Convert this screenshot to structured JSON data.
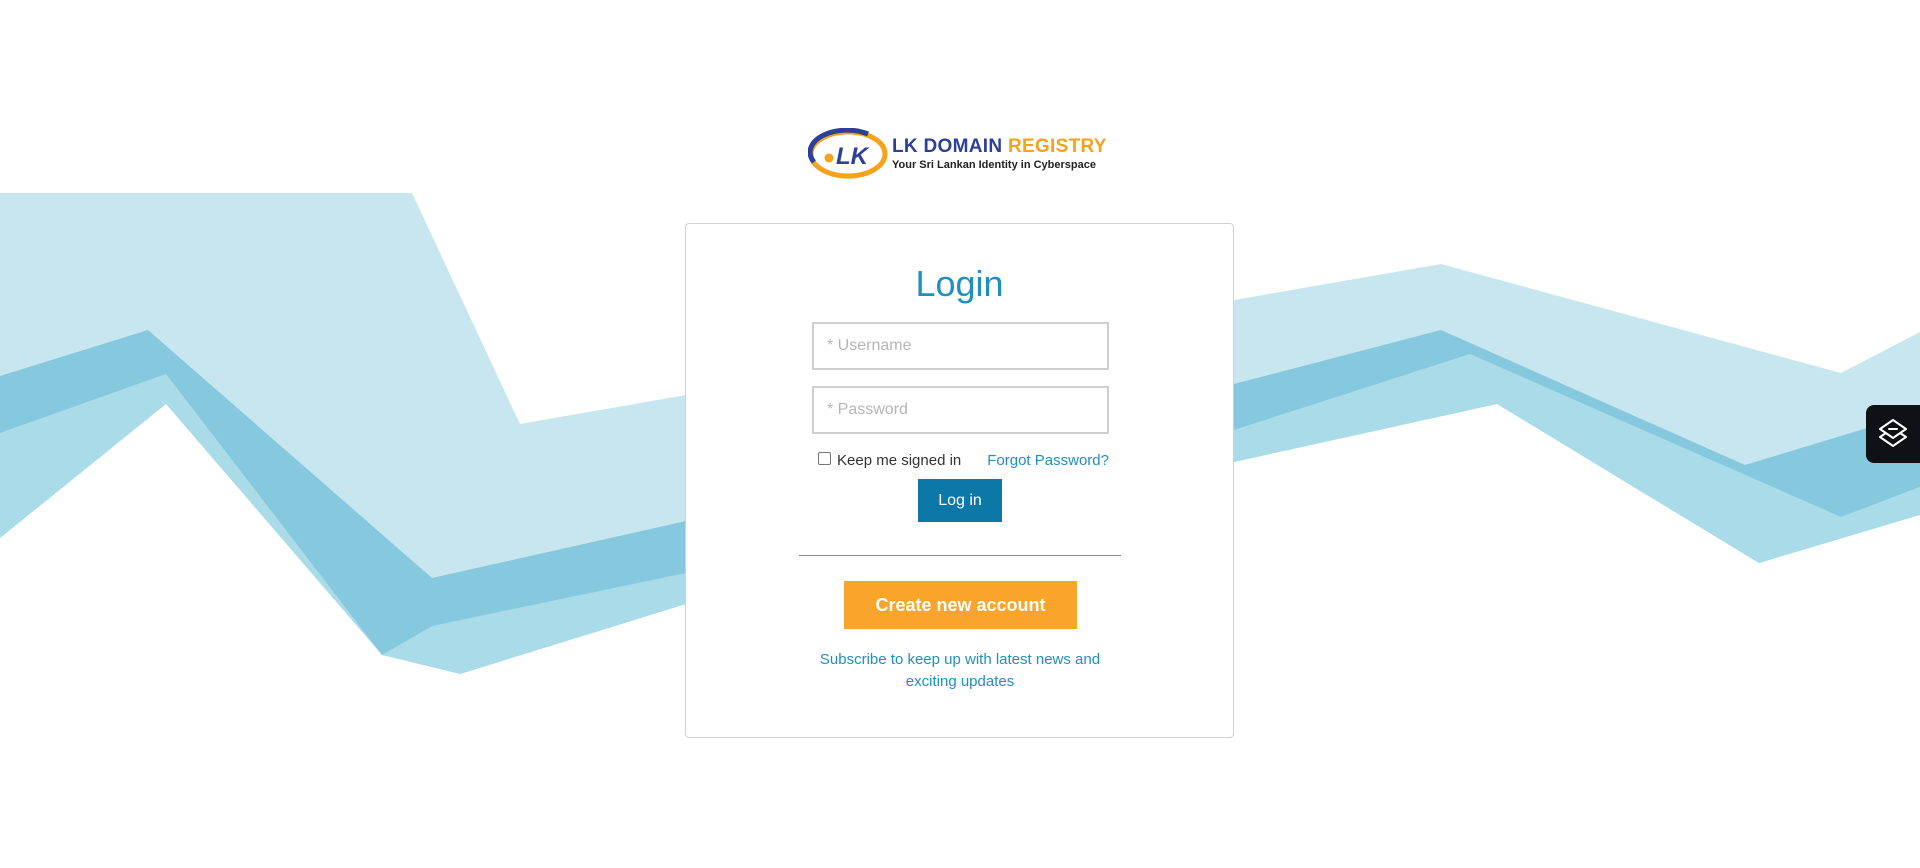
{
  "logo": {
    "mark_text": ".LK",
    "title_part1": "LK DOMAIN",
    "title_part2": "REGISTRY",
    "tagline": "Your Sri Lankan Identity in Cyberspace"
  },
  "login": {
    "title": "Login",
    "username_placeholder": "* Username",
    "password_placeholder": "* Password",
    "keep_signed_in_label": "Keep me signed in",
    "keep_signed_in_checked": false,
    "forgot_password_label": "Forgot Password?",
    "login_button_label": "Log in",
    "create_account_label": "Create new account",
    "subscribe_text": "Subscribe to keep up with latest news and exciting updates"
  },
  "colors": {
    "accent_blue": "#1f8fc2",
    "login_button": "#0b78a8",
    "create_button": "#f9a52b",
    "wave_light": "#c7e6f0",
    "wave_mid": "#a9dbe8",
    "wave_dark": "#86c8de",
    "logo_blue": "#2b3f9b",
    "logo_orange": "#f7a21b"
  },
  "side_widget": {
    "icon": "layers-diamond-icon"
  }
}
